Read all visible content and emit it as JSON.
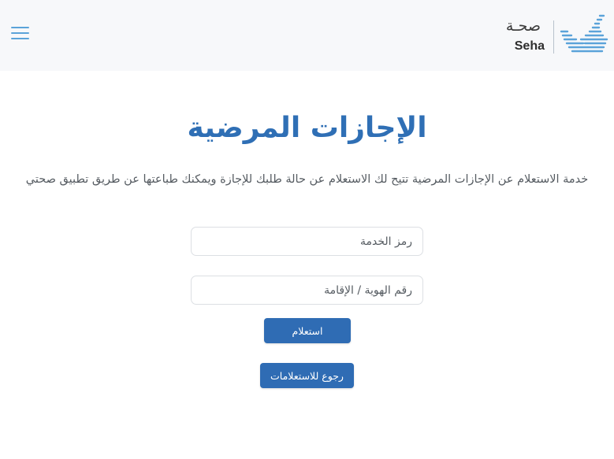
{
  "header": {
    "logo_text_ar": "صحـة",
    "logo_text_en": "Seha",
    "menu_icon": "hamburger-menu-icon",
    "logo_icon": "seha-check-logo-icon",
    "background": "#f7f8fa"
  },
  "main": {
    "title": "الإجازات المرضية",
    "description": "خدمة الاستعلام عن الإجازات المرضية تتيح لك الاستعلام عن حالة طلبك للإجازة ويمكنك طباعتها عن طريق تطبيق صحتي",
    "form": {
      "service_code_placeholder": "رمز الخدمة",
      "id_number_placeholder": "رقم الهوية / الإقامة",
      "submit_label": "استعلام",
      "back_label": "رجوع للاستعلامات"
    }
  },
  "colors": {
    "primary": "#2f6cb4",
    "title": "#2f6fb5",
    "accent": "#5ba3d9"
  }
}
